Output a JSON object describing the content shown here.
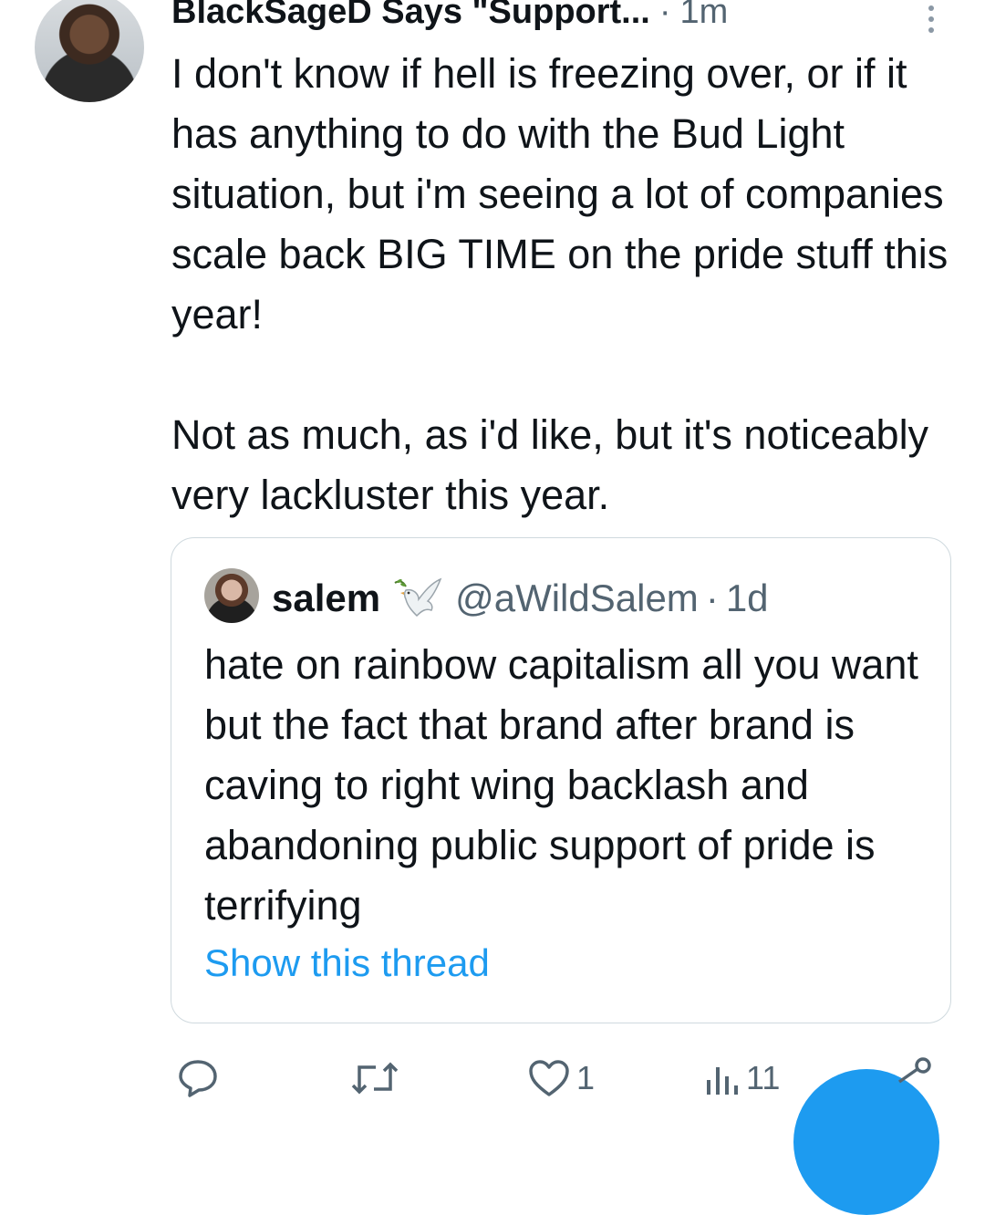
{
  "tweet": {
    "author_name": "BlackSageD Says \"Support...",
    "separator": "·",
    "time": "1m",
    "text": "I don't know if hell is freezing over, or if it has anything to do with the Bud Light situation, but i'm seeing a lot of companies scale back BIG TIME on the pride stuff this year!\n\nNot as much, as i'd like, but it's noticeably very lackluster this year."
  },
  "quote": {
    "name": "salem",
    "handle": "@aWildSalem",
    "separator": "·",
    "time": "1d",
    "text": "hate on rainbow capitalism all you want but the fact that brand after brand is caving to right wing backlash and abandoning public support of pride is terrifying",
    "show_thread": "Show this thread"
  },
  "actions": {
    "like_count": "1",
    "views_count": "11"
  },
  "icons": [
    "more-icon",
    "dove-icon",
    "reply-icon",
    "retweet-icon",
    "like-icon",
    "views-icon",
    "share-icon"
  ],
  "colors": {
    "accent": "#1d9bf0",
    "muted": "#536471",
    "text": "#0f1419",
    "border": "#cfd9de"
  }
}
